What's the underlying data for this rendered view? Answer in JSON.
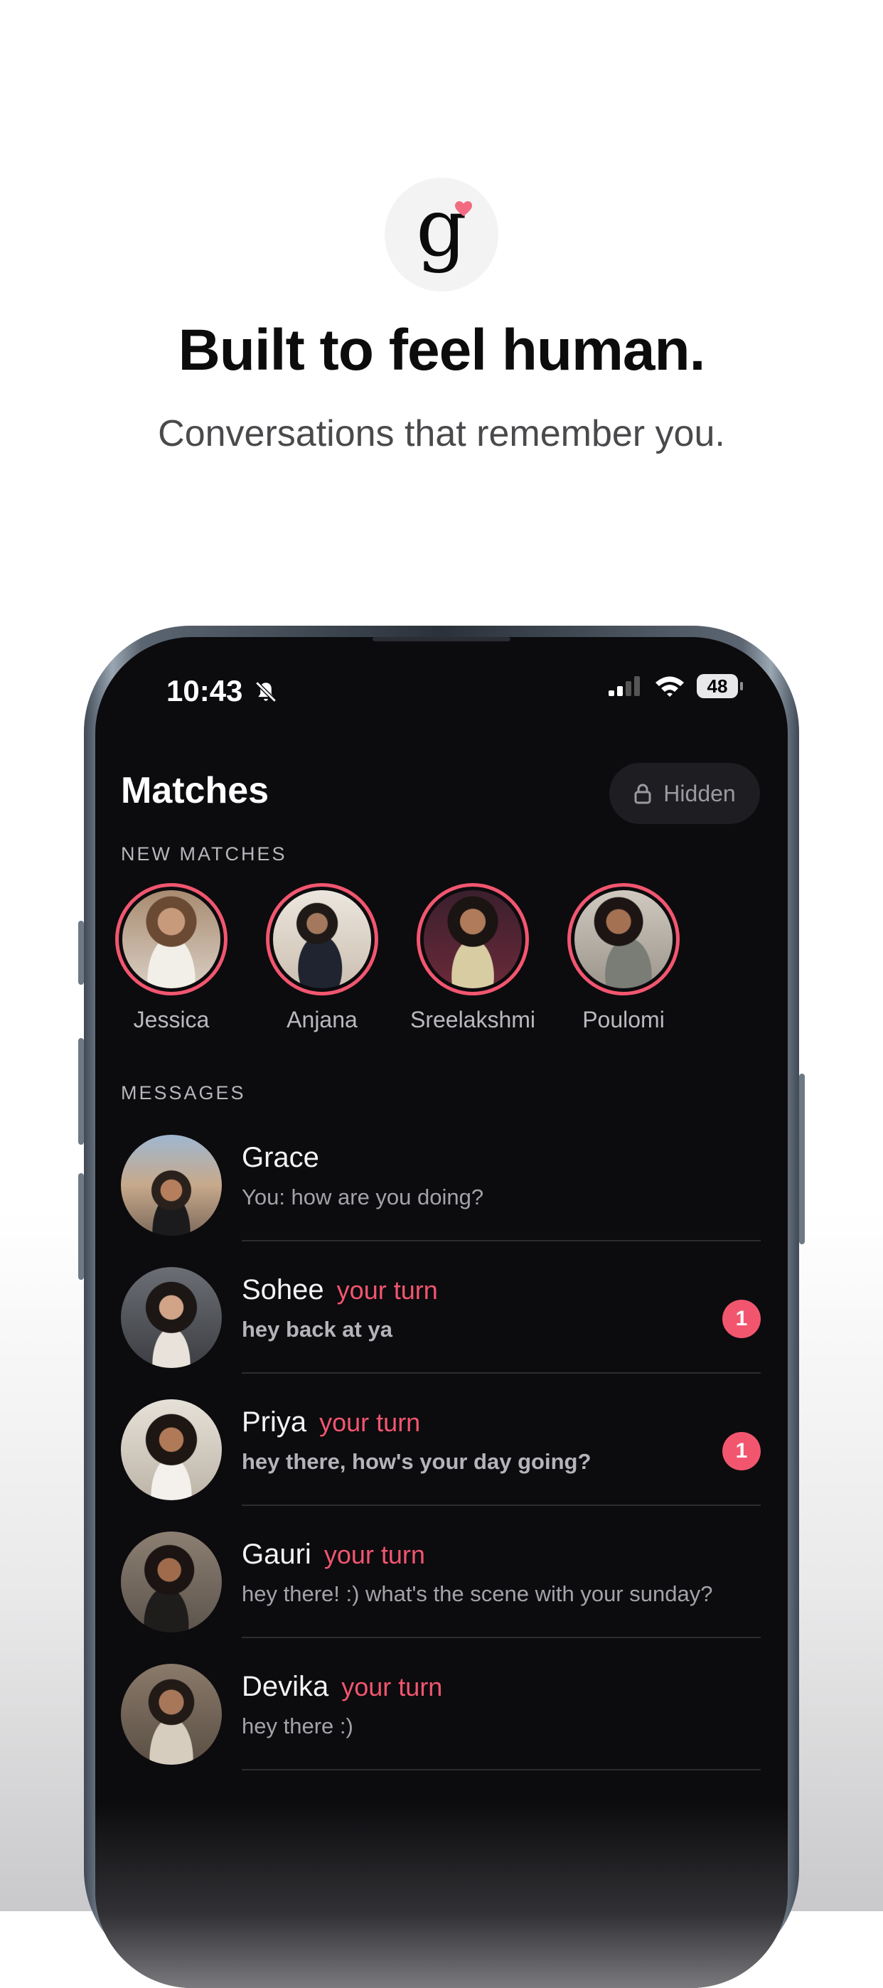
{
  "hero": {
    "headline": "Built to feel human.",
    "subline": "Conversations that remember you.",
    "logo_letter": "g",
    "accent_color": "#f2566f"
  },
  "status_bar": {
    "time": "10:43",
    "battery": "48",
    "icons": [
      "bell-slash-icon",
      "signal-icon",
      "wifi-icon",
      "battery-icon"
    ]
  },
  "header": {
    "title": "Matches",
    "hidden_label": "Hidden",
    "hidden_icon": "lock-icon"
  },
  "new_matches": {
    "label": "NEW MATCHES",
    "items": [
      {
        "name": "Jessica"
      },
      {
        "name": "Anjana"
      },
      {
        "name": "Sreelakshmi"
      },
      {
        "name": "Poulomi"
      }
    ]
  },
  "messages": {
    "label": "MESSAGES",
    "items": [
      {
        "name": "Grace",
        "turn": "",
        "preview": "You: how are you doing?",
        "badge": ""
      },
      {
        "name": "Sohee",
        "turn": "your turn",
        "preview": "hey back at ya",
        "badge": "1"
      },
      {
        "name": "Priya",
        "turn": "your turn",
        "preview": "hey there, how's your day going?",
        "badge": "1"
      },
      {
        "name": "Gauri",
        "turn": "your turn",
        "preview": "hey there! :) what's the scene with your sunday?",
        "badge": ""
      },
      {
        "name": "Devika",
        "turn": "your turn",
        "preview": "hey there :)",
        "badge": ""
      }
    ]
  }
}
